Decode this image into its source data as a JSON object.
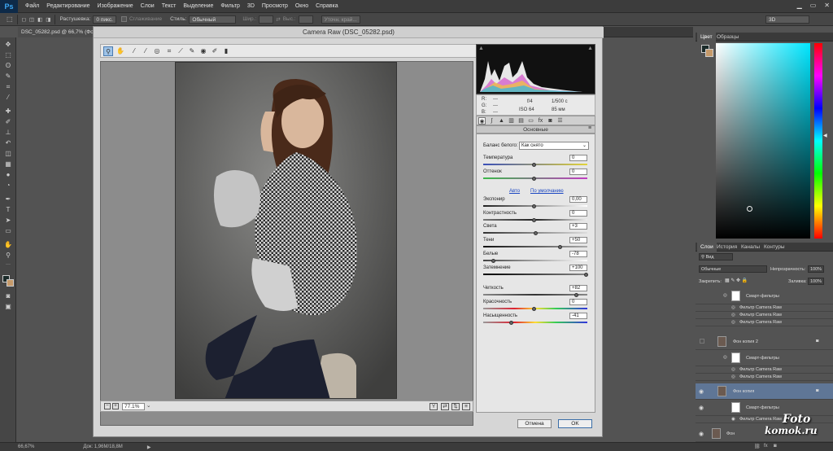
{
  "app": {
    "logo": "Ps"
  },
  "menu": [
    "Файл",
    "Редактирование",
    "Изображение",
    "Слои",
    "Текст",
    "Выделение",
    "Фильтр",
    "3D",
    "Просмотр",
    "Окно",
    "Справка"
  ],
  "options": {
    "feather_label": "Растушевка:",
    "feather_value": "0 пикс.",
    "antialias_label": "Сглаживание",
    "style_label": "Стиль:",
    "style_value": "Обычный",
    "width_label": "Шир.:",
    "height_label": "Выс.:",
    "refine_label": "Уточн. край...",
    "workspace": "3D"
  },
  "document": {
    "tab": "DSC_05282.psd @ 66,7% (Фон к..."
  },
  "status": {
    "zoom": "66,67%",
    "doc": "Док: 1,96M/18,8M"
  },
  "camera_raw": {
    "title": "Camera Raw (DSC_05282.psd)",
    "zoom": "77.1%",
    "info": {
      "r": "R:",
      "g": "G:",
      "b": "B:",
      "dash": "---",
      "aperture": "f/4",
      "shutter": "1/500 с",
      "iso": "ISO 64",
      "focal": "85 мм"
    },
    "panel_title": "Основные",
    "wb_label": "Баланс белого:",
    "wb_value": "Как снято",
    "temp_label": "Температура",
    "temp_value": "0",
    "tint_label": "Оттенок",
    "tint_value": "0",
    "auto_link": "Авто",
    "default_link": "По умолчанию",
    "exposure_label": "Экспонир",
    "exposure_value": "0,00",
    "contrast_label": "Контрастность",
    "contrast_value": "0",
    "highlights_label": "Света",
    "highlights_value": "+3",
    "shadows_label": "Тени",
    "shadows_value": "+50",
    "whites_label": "Белые",
    "whites_value": "-78",
    "blacks_label": "Затемнение",
    "blacks_value": "+100",
    "clarity_label": "Четкость",
    "clarity_value": "+82",
    "vibrance_label": "Красочность",
    "vibrance_value": "0",
    "saturation_label": "Насыщенность",
    "saturation_value": "-41",
    "cancel": "Отмена",
    "ok": "OK"
  },
  "panels": {
    "color_tab": "Цвет",
    "swatches_tab": "Образцы",
    "layers_tab": "Слои",
    "history_tab": "История",
    "channels_tab": "Каналы",
    "paths_tab": "Контуры",
    "kind_label": "Вид",
    "blend_mode": "Обычные",
    "opacity_label": "Непрозрачность:",
    "opacity_value": "100%",
    "lock_label": "Закрепить:",
    "fill_label": "Заливка:",
    "fill_value": "100%"
  },
  "layers": [
    {
      "name": "Смарт-фильтры",
      "type": "smart"
    },
    {
      "name": "Фильтр Camera Raw",
      "type": "filter"
    },
    {
      "name": "Фильтр Camera Raw",
      "type": "filter"
    },
    {
      "name": "Фильтр Camera Raw",
      "type": "filter"
    },
    {
      "name": "Фон копия 2",
      "type": "layer"
    },
    {
      "name": "Смарт-фильтры",
      "type": "smart"
    },
    {
      "name": "Фильтр Camera Raw",
      "type": "filter"
    },
    {
      "name": "Фильтр Camera Raw",
      "type": "filter"
    },
    {
      "name": "Фон копия",
      "type": "layer"
    },
    {
      "name": "Смарт-фильтры",
      "type": "smart"
    },
    {
      "name": "Фильтр Camera Raw",
      "type": "filter"
    },
    {
      "name": "Фон",
      "type": "layer"
    }
  ],
  "watermark": {
    "line1": "Foto",
    "line2": "komok.ru"
  }
}
